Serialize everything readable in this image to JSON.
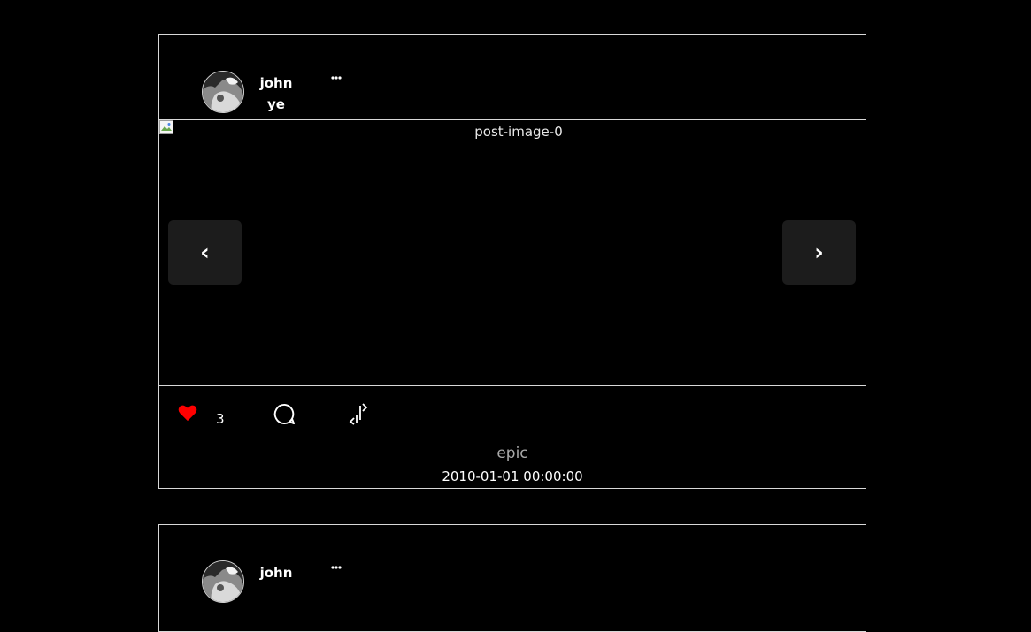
{
  "posts": [
    {
      "username": "john",
      "display_name": "ye",
      "image_alt": "post-image-0",
      "prev_label": "‹",
      "next_label": "›",
      "like_count": "3",
      "caption": "epic",
      "timestamp": "2010-01-01 00:00:00"
    },
    {
      "username": "john"
    }
  ],
  "icons": {
    "more": "more-horizontal-icon",
    "like": "heart-icon",
    "comment": "comment-bubble-icon",
    "share": "share-arrows-icon"
  },
  "colors": {
    "background": "#000000",
    "border": "#d8d8d8",
    "like_active": "#ff0000",
    "nav_button_bg": "#1c1c1c",
    "caption_text": "#a9a9a9"
  }
}
